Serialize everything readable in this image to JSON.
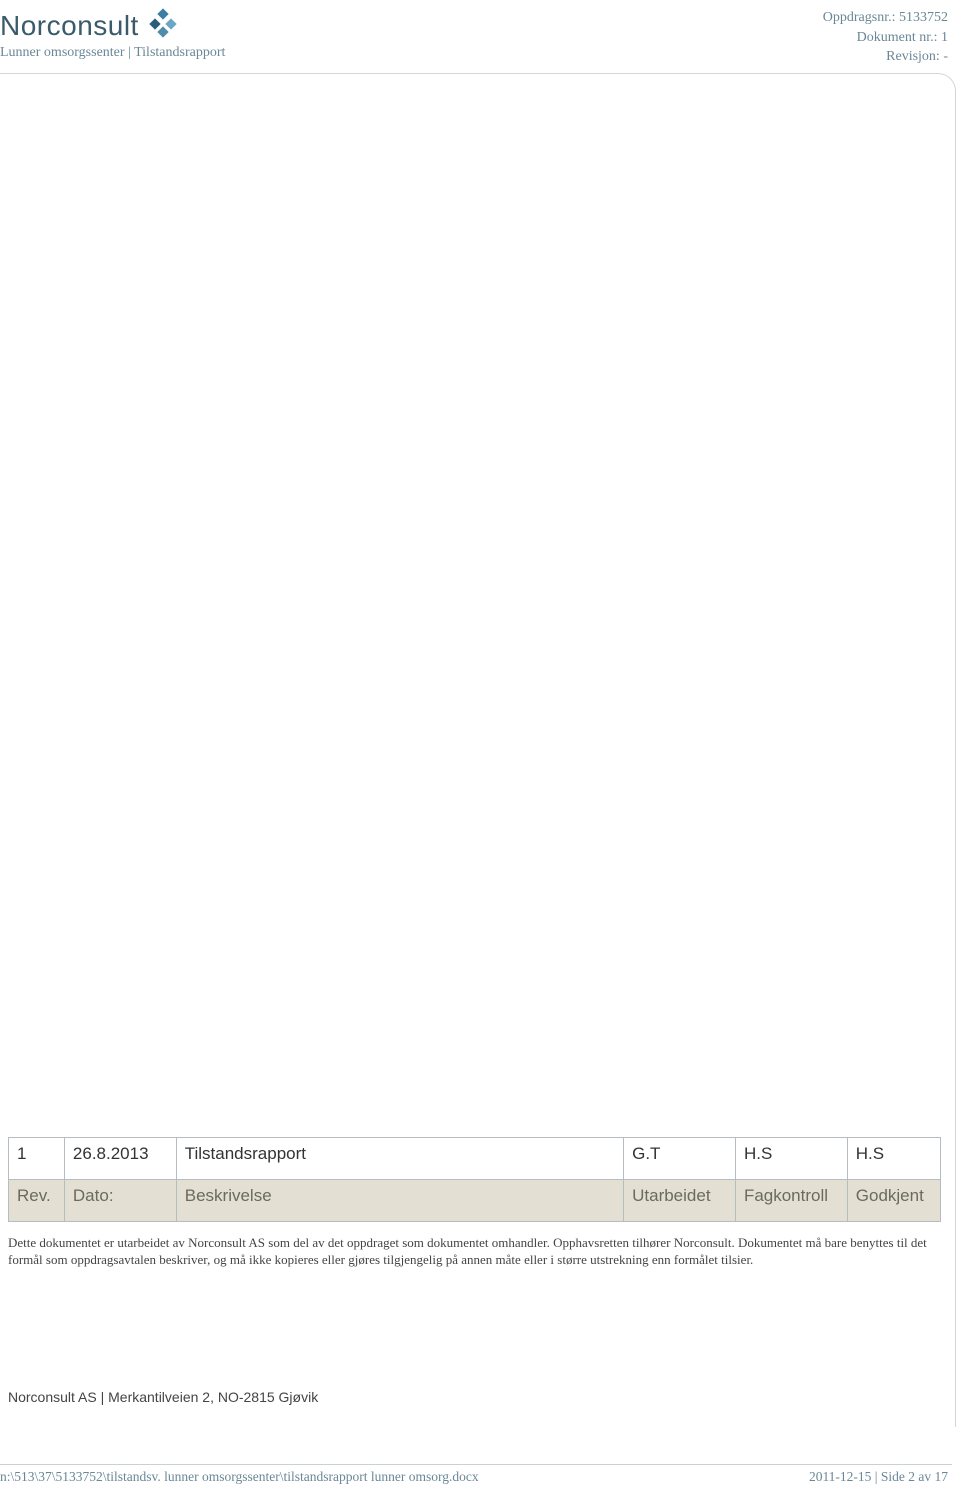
{
  "header": {
    "logo_text": "Norconsult",
    "subtitle": "Lunner omsorgssenter | Tilstandsrapport",
    "oppdragsnr_label": "Oppdragsnr.:",
    "oppdragsnr_value": "5133752",
    "dokument_label": "Dokument nr.:",
    "dokument_value": "1",
    "revisjon_label": "Revisjon:",
    "revisjon_value": "-"
  },
  "table": {
    "headers": {
      "rev": "Rev.",
      "dato": "Dato:",
      "beskrivelse": "Beskrivelse",
      "utarbeidet": "Utarbeidet",
      "fagkontroll": "Fagkontroll",
      "godkjent": "Godkjent"
    },
    "rows": [
      {
        "rev": "1",
        "dato": "26.8.2013",
        "beskrivelse": "Tilstandsrapport",
        "utarbeidet": "G.T",
        "fagkontroll": "H.S",
        "godkjent": "H.S"
      }
    ]
  },
  "disclaimer": "Dette dokumentet er utarbeidet av Norconsult AS som del av det oppdraget som dokumentet omhandler. Opphavsretten tilhører Norconsult. Dokumentet må bare benyttes til det formål som oppdragsavtalen beskriver, og må ikke kopieres eller gjøres tilgjengelig på annen måte eller i større utstrekning enn formålet tilsier.",
  "address": "Norconsult AS | Merkantilveien 2, NO-2815 Gjøvik",
  "footer": {
    "path": "n:\\513\\37\\5133752\\tilstandsv. lunner omsorgssenter\\tilstandsrapport lunner omsorg.docx",
    "date_page": "2011-12-15 | Side 2 av 17"
  }
}
